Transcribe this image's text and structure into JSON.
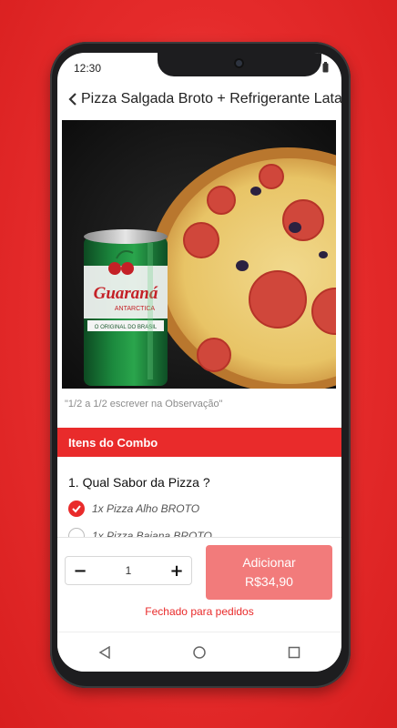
{
  "status": {
    "time": "12:30"
  },
  "header": {
    "title": "Pizza Salgada Broto + Refrigerante Lata"
  },
  "product": {
    "can_brand": "Guaraná",
    "can_sub": "ANTARCTICA",
    "can_tag": "O ORIGINAL DO BRASIL",
    "note": "\"1/2 a 1/2 escrever na Observação\""
  },
  "combo": {
    "section_title": "Itens do Combo",
    "question": "1. Qual Sabor da Pizza ?",
    "options": [
      {
        "label": "1x Pizza Alho BROTO",
        "selected": true
      },
      {
        "label": "1x Pizza Baiana BROTO",
        "selected": false
      }
    ]
  },
  "order": {
    "minus": "−",
    "quantity": "1",
    "plus": "+",
    "add_label": "Adicionar",
    "price": "R$34,90",
    "closed_text": "Fechado para pedidos"
  },
  "colors": {
    "accent": "#e92b2b",
    "button": "#f27b7b"
  }
}
